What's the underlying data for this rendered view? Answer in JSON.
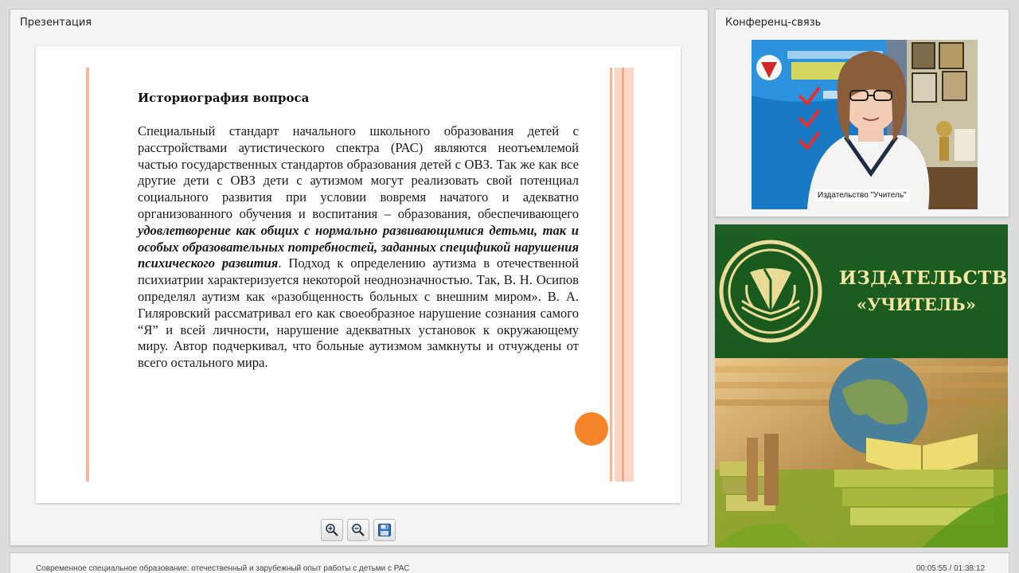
{
  "presentation": {
    "panel_title": "Презентация",
    "slide": {
      "heading": "Историография вопроса",
      "body_1": "Специальный стандарт начального школьного образования детей с расстройствами аутистического спектра (РАС) являются неотъемлемой частью государственных стандартов образования детей с ОВЗ. Так же как все другие дети с ОВЗ дети с аутизмом могут реализовать свой потенциал социального развития при условии вовремя начатого и адекватно организованного обучения и воспитания – образования, обеспечивающего ",
      "body_bold": "удовлетворение как общих с нормально развивающимися детьми, так и особых образовательных потребностей, заданных спецификой нарушения психического развития",
      "body_2": ". Подход к определению аутизма в отечественной психиатрии характеризуется некоторой неоднозначностью. Так, В. Н. Осипов определял аутизм как «разобщенность больных с внешним миром». В. А. Гиляровский рассматривал его как своеобразное нарушение сознания самого “Я” и всей личности, нарушение адекватных установок к окружающему миру. Автор подчеркивал, что больные аутизмом замкнуты и отчуждены от всего остального мира."
    },
    "toolbar": {
      "zoom_in_icon": "zoom-in-magnifier",
      "zoom_out_icon": "zoom-out-magnifier",
      "save_icon": "floppy-disk"
    }
  },
  "conference": {
    "panel_title": "Конференц-связь",
    "video_label": "Издательство \"Учитель\""
  },
  "promo": {
    "name_line_1": "ИЗДАТЕЛЬСТВО",
    "name_line_2": "«УЧИТЕЛЬ»"
  },
  "footer": {
    "course_title": "Современное специальное образование: отечественный и зарубежный опыт работы с детьми с РАС",
    "time": "00:05:55 / 01:38:12"
  },
  "colors": {
    "accent_orange": "#f6842a",
    "slide_stripe": "#f3b79a",
    "publisher_green": "#1d5e22",
    "publisher_gold": "#f4e7a4"
  }
}
